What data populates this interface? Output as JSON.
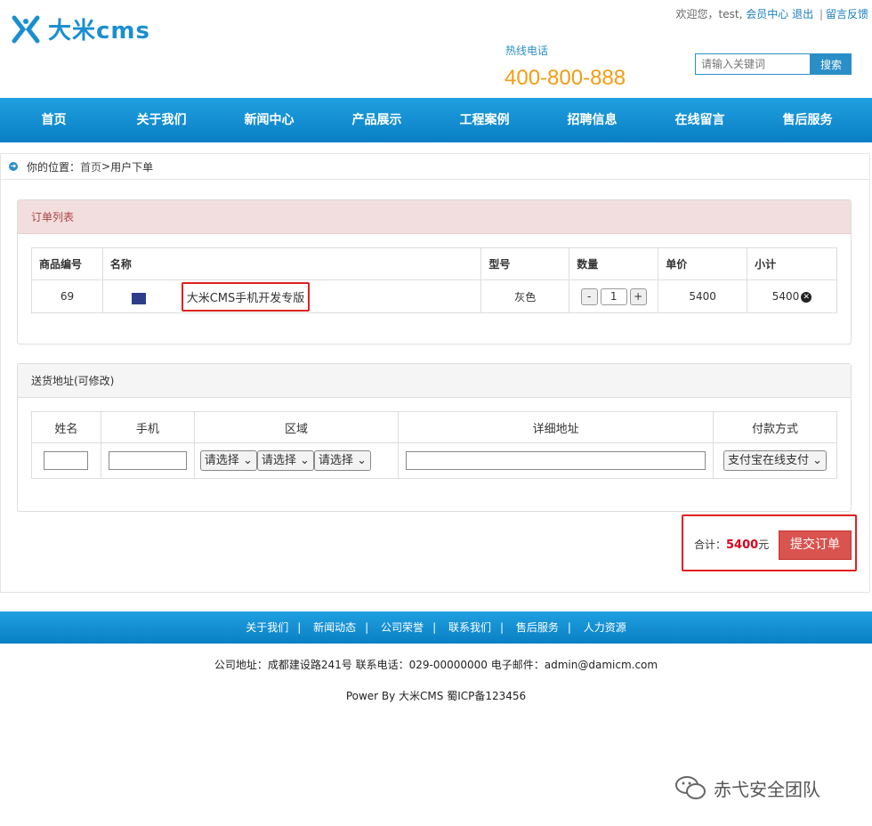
{
  "header": {
    "logo_text": "大米cms",
    "welcome": "欢迎您，test,",
    "member_center": "会员中心",
    "logout": "退出",
    "sep": "|",
    "feedback": "留言反馈",
    "hotline_label": "热线电话",
    "hotline_number": "400-800-888",
    "search_placeholder": "请输入关键词",
    "search_button": "搜索"
  },
  "nav": [
    "首页",
    "关于我们",
    "新闻中心",
    "产品展示",
    "工程案例",
    "招聘信息",
    "在线留言",
    "售后服务"
  ],
  "breadcrumb": {
    "prefix": "你的位置：",
    "home": "首页",
    "sep": " > ",
    "current": "用户下单"
  },
  "order": {
    "title": "订单列表",
    "headers": [
      "商品编号",
      "名称",
      "型号",
      "数量",
      "单价",
      "小计"
    ],
    "row": {
      "id": "69",
      "name": "大米CMS手机开发专版",
      "model": "灰色",
      "qty_minus": "-",
      "qty": "1",
      "qty_plus": "+",
      "price": "5400",
      "subtotal": "5400"
    }
  },
  "address": {
    "title": "送货地址(可修改)",
    "headers": [
      "姓名",
      "手机",
      "区域",
      "详细地址",
      "付款方式"
    ],
    "region_selects": [
      "请选择",
      "请选择",
      "请选择"
    ],
    "payment": "支付宝在线支付"
  },
  "total": {
    "label": "合计：",
    "amount": "5400",
    "unit": "元",
    "submit": "提交订单"
  },
  "footer": {
    "links": [
      "关于我们",
      "新闻动态",
      "公司荣誉",
      "联系我们",
      "售后服务",
      "人力资源"
    ],
    "sep": "|",
    "address_line": "公司地址：成都建设路241号 联系电话：029-00000000 电子邮件：admin@damicm.com",
    "power_line": "Power By 大米CMS  蜀ICP备123456"
  },
  "watermark": "赤弋安全团队",
  "colors": {
    "brand_blue": "#1a8fd0",
    "hotline_orange": "#f39c12",
    "alert_red": "#d9534f",
    "highlight_red": "#e02020"
  }
}
